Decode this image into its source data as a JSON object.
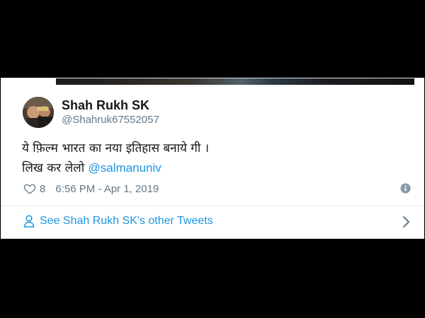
{
  "tweet": {
    "author_name": "Shah Rukh SK",
    "author_handle": "@Shahruk67552057",
    "text_line1": "ये  फ़िल्म भारत का नया  इतिहास  बनाये गी ।",
    "text_line2_prefix": "लिख कर लेलो ",
    "mention": "@salmanuniv",
    "like_count": "8",
    "timestamp": "6:56 PM - Apr 1, 2019"
  },
  "footer": {
    "other_tweets_label": "See Shah Rukh SK's other Tweets"
  },
  "icons": {
    "like": "heart-icon",
    "info": "info-icon",
    "profile": "person-icon",
    "next": "chevron-right-icon"
  },
  "colors": {
    "link": "#1b95e0",
    "text": "#14171a",
    "secondary": "#657786",
    "background": "#000000"
  }
}
